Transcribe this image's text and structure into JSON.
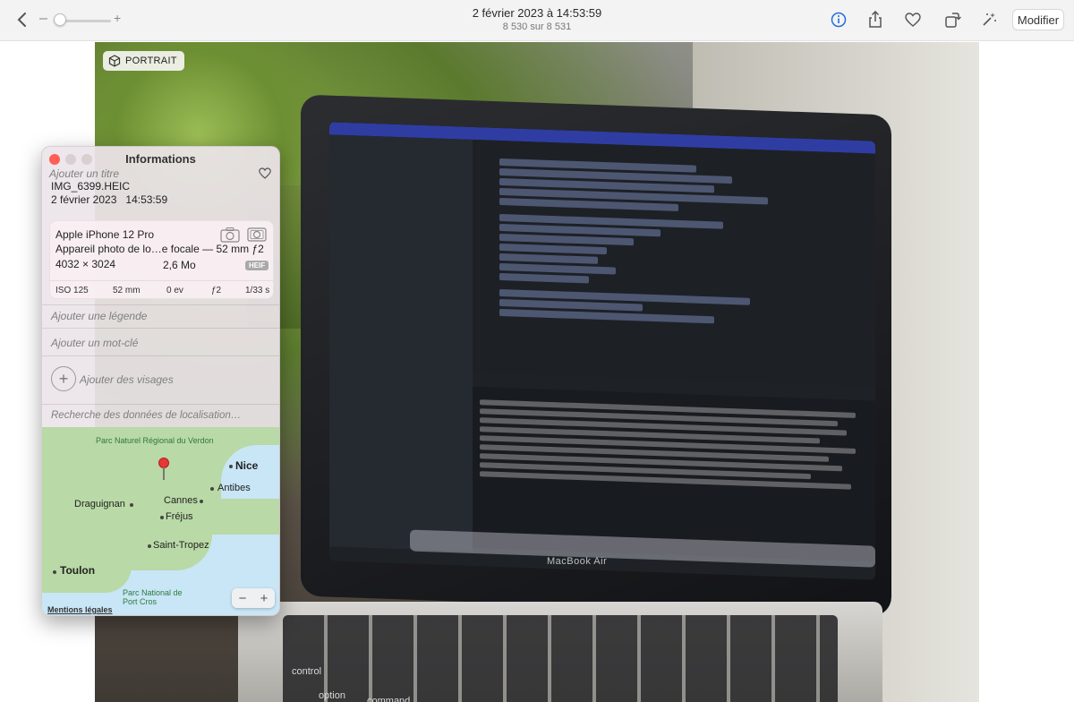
{
  "toolbar": {
    "title": "2 février 2023 à 14:53:59",
    "subtitle": "8 530 sur 8 531",
    "zoom_minus": "–",
    "zoom_plus": "+",
    "edit_label": "Modifier",
    "accent_color": "#1f6fe0"
  },
  "photo": {
    "badge": "PORTRAIT",
    "laptop_brand": "MacBook Air",
    "keys": [
      "control",
      "option",
      "command"
    ]
  },
  "info": {
    "title": "Informations",
    "add_title_placeholder": "Ajouter un titre",
    "file_name": "IMG_6399.HEIC",
    "date": "2 février 2023",
    "time": "14:53:59",
    "device": "Apple iPhone 12 Pro",
    "lens": "Appareil photo de lo…e focale — 52 mm ƒ2",
    "resolution": "4032 × 3024",
    "size": "2,6 Mo",
    "format": "HEIF",
    "exif": [
      "ISO 125",
      "52 mm",
      "0 ev",
      "ƒ2",
      "1/33 s"
    ],
    "caption_placeholder": "Ajouter une légende",
    "keyword_placeholder": "Ajouter un mot-clé",
    "faces_label": "Ajouter des visages",
    "location_placeholder": "Recherche des données de localisation…"
  },
  "map": {
    "labels": {
      "park1": "Parc Naturel Régional du Verdon",
      "nice": "Nice",
      "antibes": "Antibes",
      "cannes": "Cannes",
      "draguignan": "Draguignan",
      "frejus": "Fréjus",
      "st_tropez": "Saint-Tropez",
      "toulon": "Toulon",
      "park2": "Parc National de Port Cros"
    },
    "zoom_out": "−",
    "zoom_in": "+",
    "legal": "Mentions légales"
  }
}
